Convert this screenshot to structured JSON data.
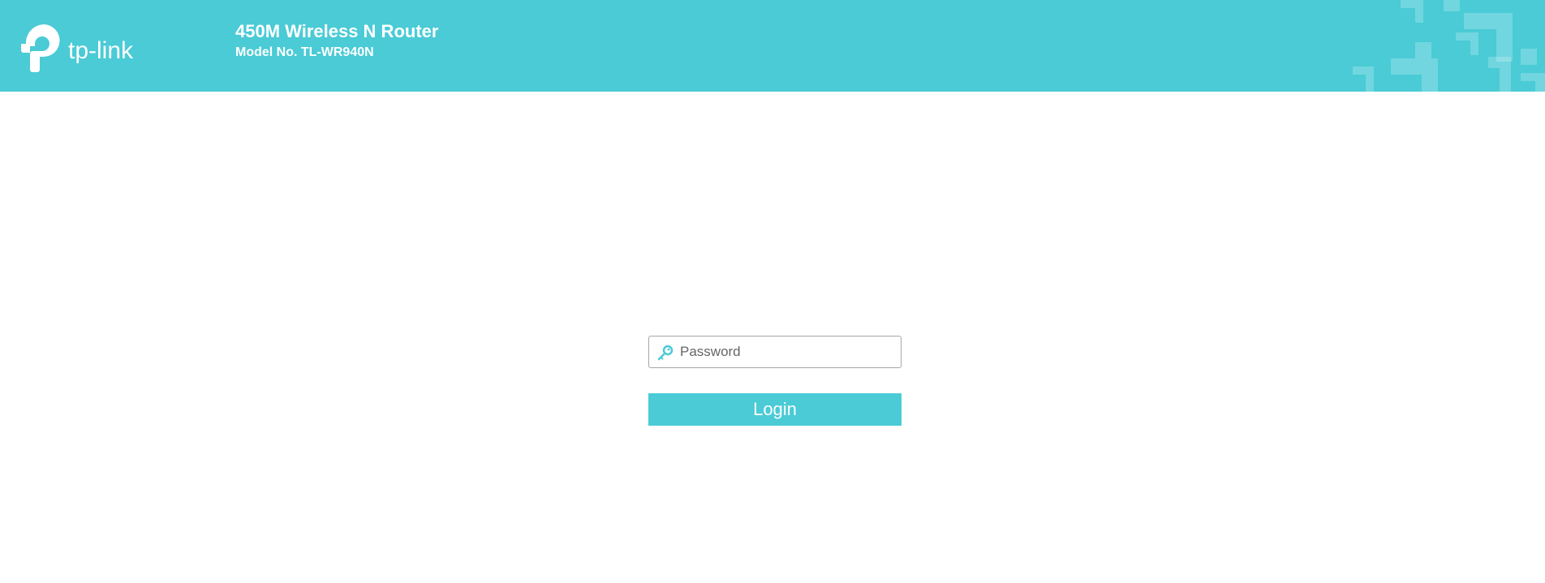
{
  "header": {
    "brand": "tp-link",
    "product_title": "450M Wireless N Router",
    "model_line": "Model No. TL-WR940N"
  },
  "login": {
    "password_placeholder": "Password",
    "login_label": "Login"
  },
  "icons": {
    "logo": "tp-link-logo",
    "password": "key-icon"
  },
  "colors": {
    "brand": "#4acbd6",
    "text_on_brand": "#ffffff",
    "field_border": "#a6a6a6"
  }
}
